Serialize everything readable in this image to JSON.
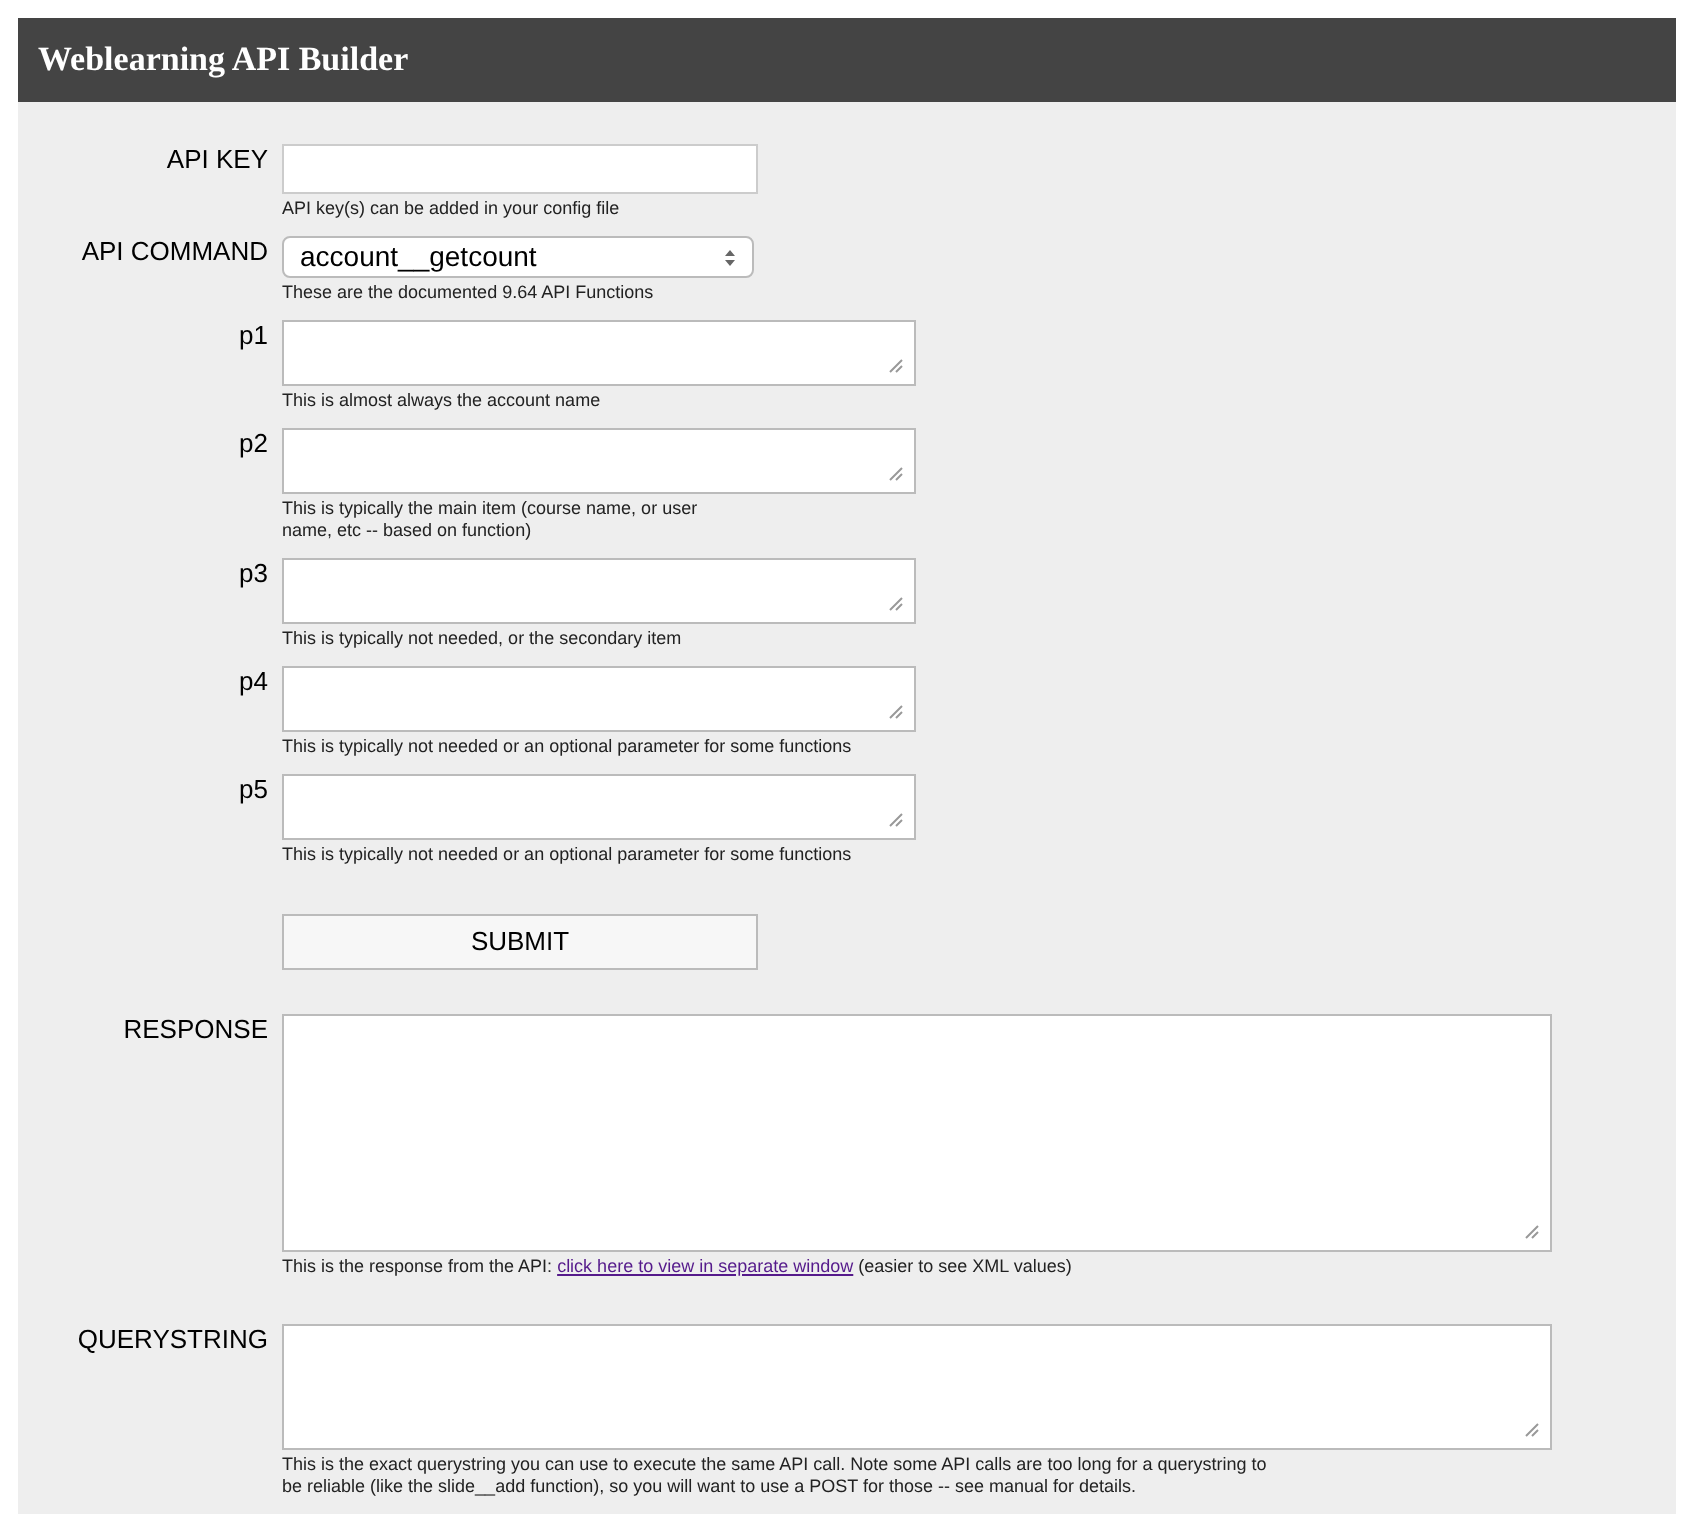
{
  "header": {
    "title": "Weblearning API Builder"
  },
  "fields": [
    {
      "kind": "input",
      "label": "API KEY",
      "help": "API key(s) can be added in your config file"
    },
    {
      "kind": "select",
      "label": "API COMMAND",
      "value": "account__getcount",
      "help": "These are the documented 9.64 API Functions"
    },
    {
      "kind": "param",
      "label": "p1",
      "help": "This is almost always the account name"
    },
    {
      "kind": "param",
      "label": "p2",
      "help": "This is typically the main item (course name, or user",
      "help_more": "name, etc -- based on function)"
    },
    {
      "kind": "param",
      "label": "p3",
      "help": "This is typically not needed, or the secondary item"
    },
    {
      "kind": "param",
      "label": "p4",
      "help": "This is typically not needed or an optional parameter for some functions"
    },
    {
      "kind": "param",
      "label": "p5",
      "help": "This is typically not needed or an optional parameter for some functions"
    },
    {
      "kind": "submit",
      "button": "SUBMIT"
    },
    {
      "kind": "output",
      "label": "RESPONSE",
      "help": "This is the response from the API: ",
      "link": "click here to view in separate window",
      "help_after": " (easier to see XML values)"
    },
    {
      "kind": "query",
      "label": "QUERYSTRING",
      "help": "This is the exact querystring you can use to execute the same API call. Note some API calls are too long for a querystring to be reliable (like the slide__add function), so you will want to use a POST for those -- see manual for details."
    }
  ]
}
